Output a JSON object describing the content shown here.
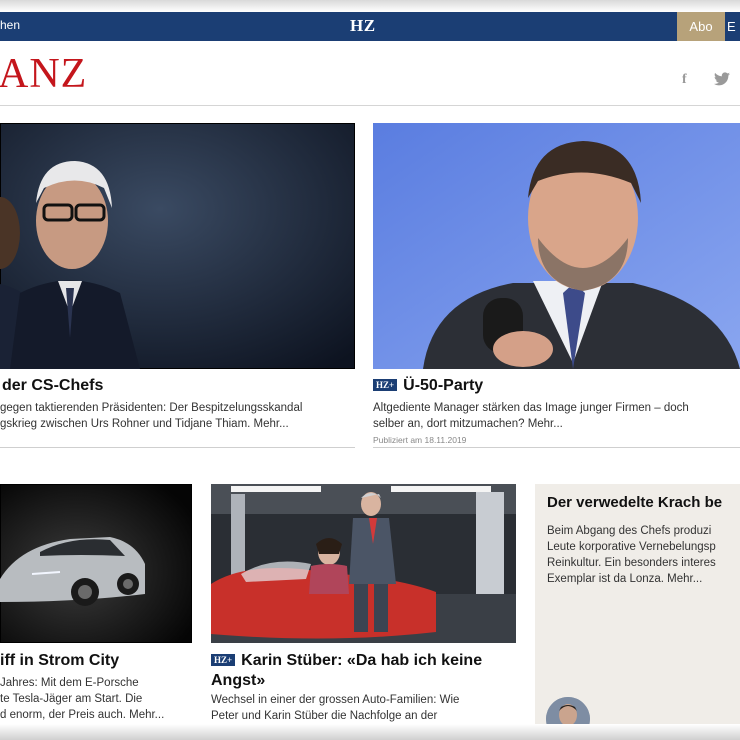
{
  "header": {
    "menu_label": "hen",
    "brand": "HZ",
    "abo_label": "Abo",
    "edge_label": "E",
    "logo_text": "ANZ"
  },
  "social": {
    "facebook_glyph": "f",
    "twitter_glyph": "🐦"
  },
  "articles": [
    {
      "headline": "der CS-Chefs",
      "teaser_line1": "gegen taktierenden Präsidenten: Der Bespitzelungsskandal",
      "teaser_line2": "gskrieg zwischen Urs Rohner und Tidjane Thiam. Mehr..."
    },
    {
      "badge": "HZ+",
      "headline": "Ü-50-Party",
      "teaser_line1": "Altgediente Manager stärken das Image junger Firmen – doch",
      "teaser_line2": "selber an, dort mitzumachen? Mehr...",
      "date": "Publiziert am 18.11.2019"
    },
    {
      "headline": "iff in Strom City",
      "teaser_line1": "Jahres: Mit dem E-Porsche",
      "teaser_line2": "te Tesla-Jäger am Start. Die",
      "teaser_line3": "d enorm, der Preis auch. Mehr..."
    },
    {
      "badge": "HZ+",
      "headline_line1": "Karin Stüber: «Da hab ich keine",
      "headline_line2": "Angst»",
      "teaser_line1": "Wechsel in einer der grossen Auto-Familien: Wie",
      "teaser_line2": "Peter und Karin Stüber die Nachfolge an der"
    }
  ],
  "sidebox": {
    "headline": "Der verwedelte Krach be",
    "line1": "Beim Abgang des Chefs produzi",
    "line2": "Leute korporative Vernebelungsp",
    "line3": "Reinkultur. Ein besonders interes",
    "line4": "Exemplar ist da Lonza. Mehr..."
  },
  "colors": {
    "navy": "#1b3e74",
    "gold": "#b7a27a",
    "logo_red": "#c4161c"
  }
}
